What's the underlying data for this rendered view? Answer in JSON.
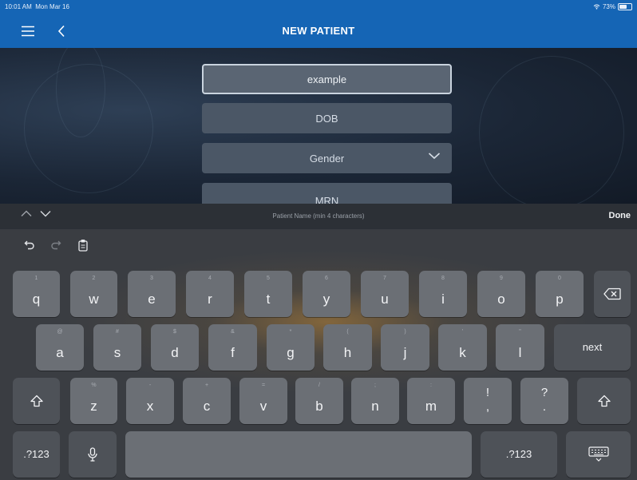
{
  "status": {
    "time": "10:01 AM",
    "date": "Mon Mar 16",
    "battery": "73%",
    "battery_level": 0.73
  },
  "nav": {
    "title": "NEW PATIENT"
  },
  "form": {
    "name_value": "example",
    "dob_placeholder": "DOB",
    "gender_placeholder": "Gender",
    "mrn_placeholder": "MRN"
  },
  "kb_toolbar": {
    "hint": "Patient Name (min 4 characters)",
    "done_label": "Done"
  },
  "keyboard": {
    "row1": [
      {
        "main": "q",
        "sub": "1"
      },
      {
        "main": "w",
        "sub": "2"
      },
      {
        "main": "e",
        "sub": "3"
      },
      {
        "main": "r",
        "sub": "4"
      },
      {
        "main": "t",
        "sub": "5"
      },
      {
        "main": "y",
        "sub": "6"
      },
      {
        "main": "u",
        "sub": "7"
      },
      {
        "main": "i",
        "sub": "8"
      },
      {
        "main": "o",
        "sub": "9"
      },
      {
        "main": "p",
        "sub": "0"
      }
    ],
    "row2": [
      {
        "main": "a",
        "sub": "@"
      },
      {
        "main": "s",
        "sub": "#"
      },
      {
        "main": "d",
        "sub": "$"
      },
      {
        "main": "f",
        "sub": "&"
      },
      {
        "main": "g",
        "sub": "*"
      },
      {
        "main": "h",
        "sub": "("
      },
      {
        "main": "j",
        "sub": ")"
      },
      {
        "main": "k",
        "sub": "'"
      },
      {
        "main": "l",
        "sub": "\""
      }
    ],
    "row3": [
      {
        "main": "z",
        "sub": "%"
      },
      {
        "main": "x",
        "sub": "-"
      },
      {
        "main": "c",
        "sub": "+"
      },
      {
        "main": "v",
        "sub": "="
      },
      {
        "main": "b",
        "sub": "/"
      },
      {
        "main": "n",
        "sub": ";"
      },
      {
        "main": "m",
        "sub": ":"
      }
    ],
    "punct": [
      {
        "top": "!",
        "bottom": ","
      },
      {
        "top": "?",
        "bottom": "."
      }
    ],
    "next_label": "next",
    "numbers_label": ".?123"
  }
}
